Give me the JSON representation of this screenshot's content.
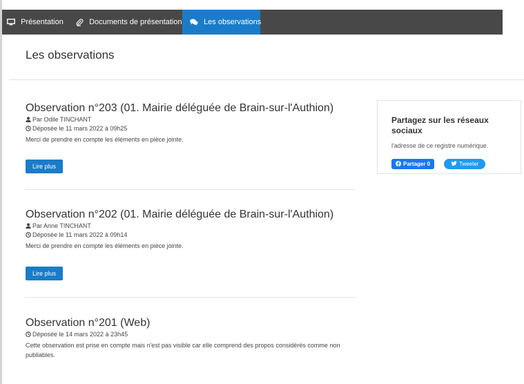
{
  "tabs": [
    {
      "label": "Présentation",
      "icon": "monitor-icon"
    },
    {
      "label": "Documents de présentation",
      "icon": "paperclip-icon"
    },
    {
      "label": "Les observations",
      "icon": "comments-icon",
      "active": true
    }
  ],
  "page_title": "Les observations",
  "observations": [
    {
      "title": "Observation n°203 (01. Mairie déléguée de Brain-sur-l'Authion)",
      "author": "Par Odile TINCHANT",
      "date": "Déposée le 11 mars 2022 à 09h25",
      "summary": "Merci de prendre en compte les éléments en pièce jointe.",
      "read_more": "Lire plus"
    },
    {
      "title": "Observation n°202 (01. Mairie déléguée de Brain-sur-l'Authion)",
      "author": "Par Anne TINCHANT",
      "date": "Déposée le 11 mars 2022 à 09h14",
      "summary": "Merci de prendre en compte les éléments en pièce jointe.",
      "read_more": "Lire plus"
    },
    {
      "title": "Observation n°201 (Web)",
      "date": "Déposée le 14 mars 2022 à 23h45",
      "summary": "Cette observation est prise en compte mais n'est pas visible car elle comprend des propos considérés comme non publiables."
    }
  ],
  "share": {
    "title": "Partagez sur les réseaux sociaux",
    "text": "l'adresse de ce registre numérique.",
    "facebook_label": "Partager 0",
    "twitter_label": "Tweeter"
  },
  "colors": {
    "tabbar_bg": "#484848",
    "active_tab": "#1a7cc8",
    "primary_button": "#1a7cc8",
    "facebook": "#1877f2",
    "twitter": "#1d9bf0"
  }
}
